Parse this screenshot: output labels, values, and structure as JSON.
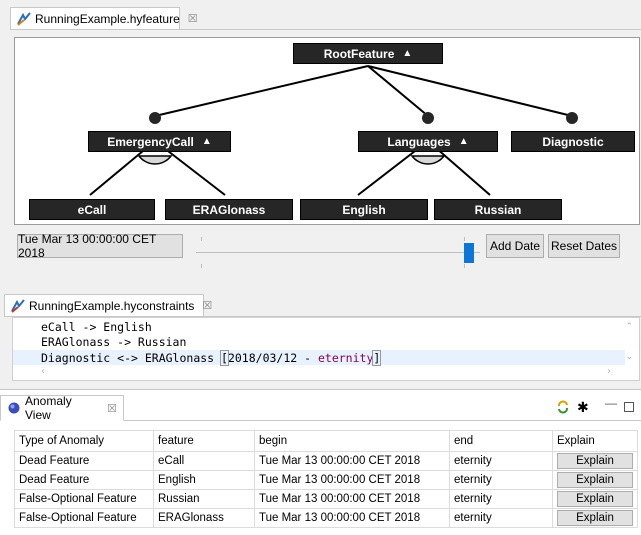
{
  "feature_editor": {
    "tab_title": "RunningExample.hyfeature",
    "tab_close": "☒",
    "features": {
      "root": "RootFeature",
      "emergency_call": "EmergencyCall",
      "languages": "Languages",
      "diagnostic": "Diagnostic",
      "ecall": "eCall",
      "eraglonass": "ERAGlonass",
      "english": "English",
      "russian": "Russian"
    },
    "collapse_glyph": "▲"
  },
  "date_bar": {
    "current_date": "Tue Mar 13 00:00:00 CET 2018",
    "add_date_label": "Add Date",
    "reset_dates_label": "Reset Dates",
    "slider_position": 1.0
  },
  "constraints_editor": {
    "tab_title": "RunningExample.hyconstraints",
    "tab_close": "☒",
    "lines": {
      "line1": "eCall -> English",
      "line2": "ERAGlonass -> Russian",
      "line3_prefix": "Diagnostic <-> ERAGlonass ",
      "line3_bracket_open": "[",
      "line3_date": "2018/03/12",
      "line3_dash": " - ",
      "line3_eternity": "eternity",
      "line3_bracket_close": "]"
    }
  },
  "anomaly_view": {
    "tab_title": "Anomaly View",
    "tab_close": "☒",
    "columns": {
      "type": "Type of Anomaly",
      "feature": "feature",
      "begin": "begin",
      "end": "end",
      "explain": "Explain"
    },
    "rows": [
      {
        "type": "Dead Feature",
        "feature": "eCall",
        "begin": "Tue Mar 13 00:00:00 CET 2018",
        "end": "eternity",
        "explain": "Explain"
      },
      {
        "type": "Dead Feature",
        "feature": "English",
        "begin": "Tue Mar 13 00:00:00 CET 2018",
        "end": "eternity",
        "explain": "Explain"
      },
      {
        "type": "False-Optional Feature",
        "feature": "Russian",
        "begin": "Tue Mar 13 00:00:00 CET 2018",
        "end": "eternity",
        "explain": "Explain"
      },
      {
        "type": "False-Optional Feature",
        "feature": "ERAGlonass",
        "begin": "Tue Mar 13 00:00:00 CET 2018",
        "end": "eternity",
        "explain": "Explain"
      }
    ]
  }
}
